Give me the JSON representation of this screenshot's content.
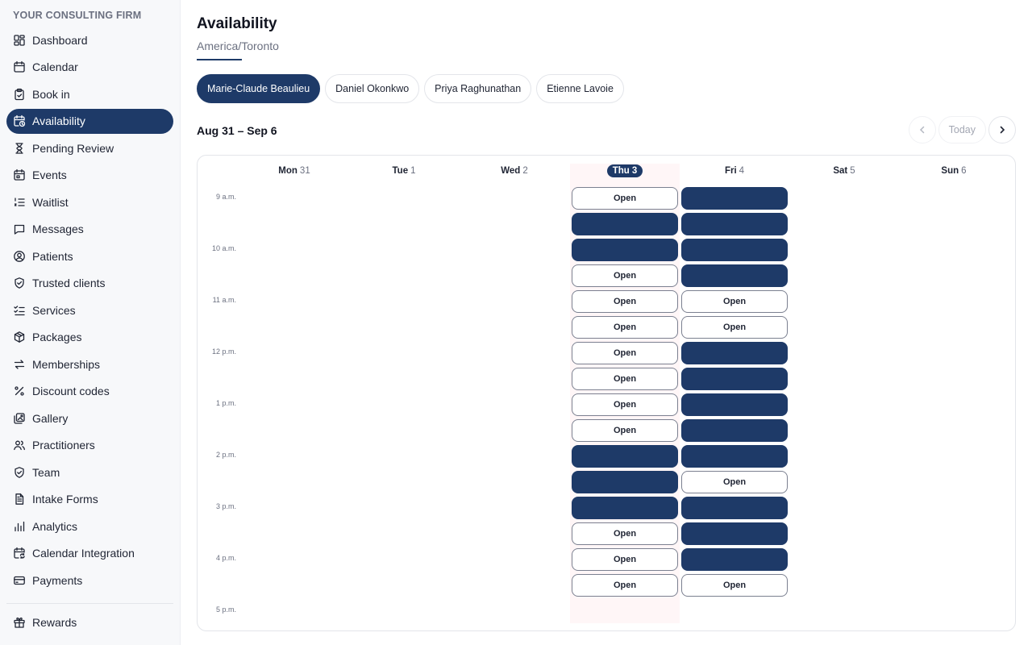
{
  "brand": "YOUR CONSULTING FIRM",
  "nav": [
    {
      "label": "Dashboard",
      "icon": "dashboard-icon",
      "active": false
    },
    {
      "label": "Calendar",
      "icon": "calendar-icon",
      "active": false
    },
    {
      "label": "Book in",
      "icon": "clipboard-icon",
      "active": false
    },
    {
      "label": "Availability",
      "icon": "calendar-clock-icon",
      "active": true
    },
    {
      "label": "Pending Review",
      "icon": "hourglass-icon",
      "active": false
    },
    {
      "label": "Events",
      "icon": "calendar-event-icon",
      "active": false
    },
    {
      "label": "Waitlist",
      "icon": "list-numbered-icon",
      "active": false
    },
    {
      "label": "Messages",
      "icon": "message-icon",
      "active": false
    },
    {
      "label": "Patients",
      "icon": "user-circle-icon",
      "active": false
    },
    {
      "label": "Trusted clients",
      "icon": "shield-check-icon",
      "active": false
    },
    {
      "label": "Services",
      "icon": "list-check-icon",
      "active": false
    },
    {
      "label": "Packages",
      "icon": "package-icon",
      "active": false
    },
    {
      "label": "Memberships",
      "icon": "arrows-swap-icon",
      "active": false
    },
    {
      "label": "Discount codes",
      "icon": "percent-icon",
      "active": false
    },
    {
      "label": "Gallery",
      "icon": "gallery-icon",
      "active": false
    },
    {
      "label": "Practitioners",
      "icon": "users-icon",
      "active": false
    },
    {
      "label": "Team",
      "icon": "shield-icon",
      "active": false
    },
    {
      "label": "Intake Forms",
      "icon": "document-icon",
      "active": false
    },
    {
      "label": "Analytics",
      "icon": "bar-chart-icon",
      "active": false
    },
    {
      "label": "Calendar Integration",
      "icon": "calendar-sync-icon",
      "active": false
    },
    {
      "label": "Payments",
      "icon": "credit-card-icon",
      "active": false
    }
  ],
  "nav_bottom": [
    {
      "label": "Rewards",
      "icon": "gift-icon"
    }
  ],
  "page": {
    "title": "Availability",
    "timezone": "America/Toronto",
    "practitioners": [
      {
        "name": "Marie-Claude Beaulieu",
        "active": true
      },
      {
        "name": "Daniel Okonkwo",
        "active": false
      },
      {
        "name": "Priya Raghunathan",
        "active": false
      },
      {
        "name": "Etienne Lavoie",
        "active": false
      }
    ],
    "range": "Aug 31 – Sep 6",
    "today_label": "Today"
  },
  "calendar": {
    "days": [
      {
        "name": "Mon",
        "num": "31",
        "today": false
      },
      {
        "name": "Tue",
        "num": "1",
        "today": false
      },
      {
        "name": "Wed",
        "num": "2",
        "today": false
      },
      {
        "name": "Thu",
        "num": "3",
        "today": true
      },
      {
        "name": "Fri",
        "num": "4",
        "today": false
      },
      {
        "name": "Sat",
        "num": "5",
        "today": false
      },
      {
        "name": "Sun",
        "num": "6",
        "today": false
      }
    ],
    "hours": [
      "9 a.m.",
      "10 a.m.",
      "11 a.m.",
      "12 p.m.",
      "1 p.m.",
      "2 p.m.",
      "3 p.m.",
      "4 p.m.",
      "5 p.m."
    ],
    "open_label": "Open",
    "slots": {
      "Thu": [
        "open",
        "booked",
        "booked",
        "open",
        "open",
        "open",
        "open",
        "open",
        "open",
        "open",
        "booked",
        "booked",
        "booked",
        "open",
        "open",
        "open"
      ],
      "Fri": [
        "booked",
        "booked",
        "booked",
        "booked",
        "open",
        "open",
        "booked",
        "booked",
        "booked",
        "booked",
        "booked",
        "open",
        "booked",
        "booked",
        "booked",
        "open"
      ]
    }
  }
}
